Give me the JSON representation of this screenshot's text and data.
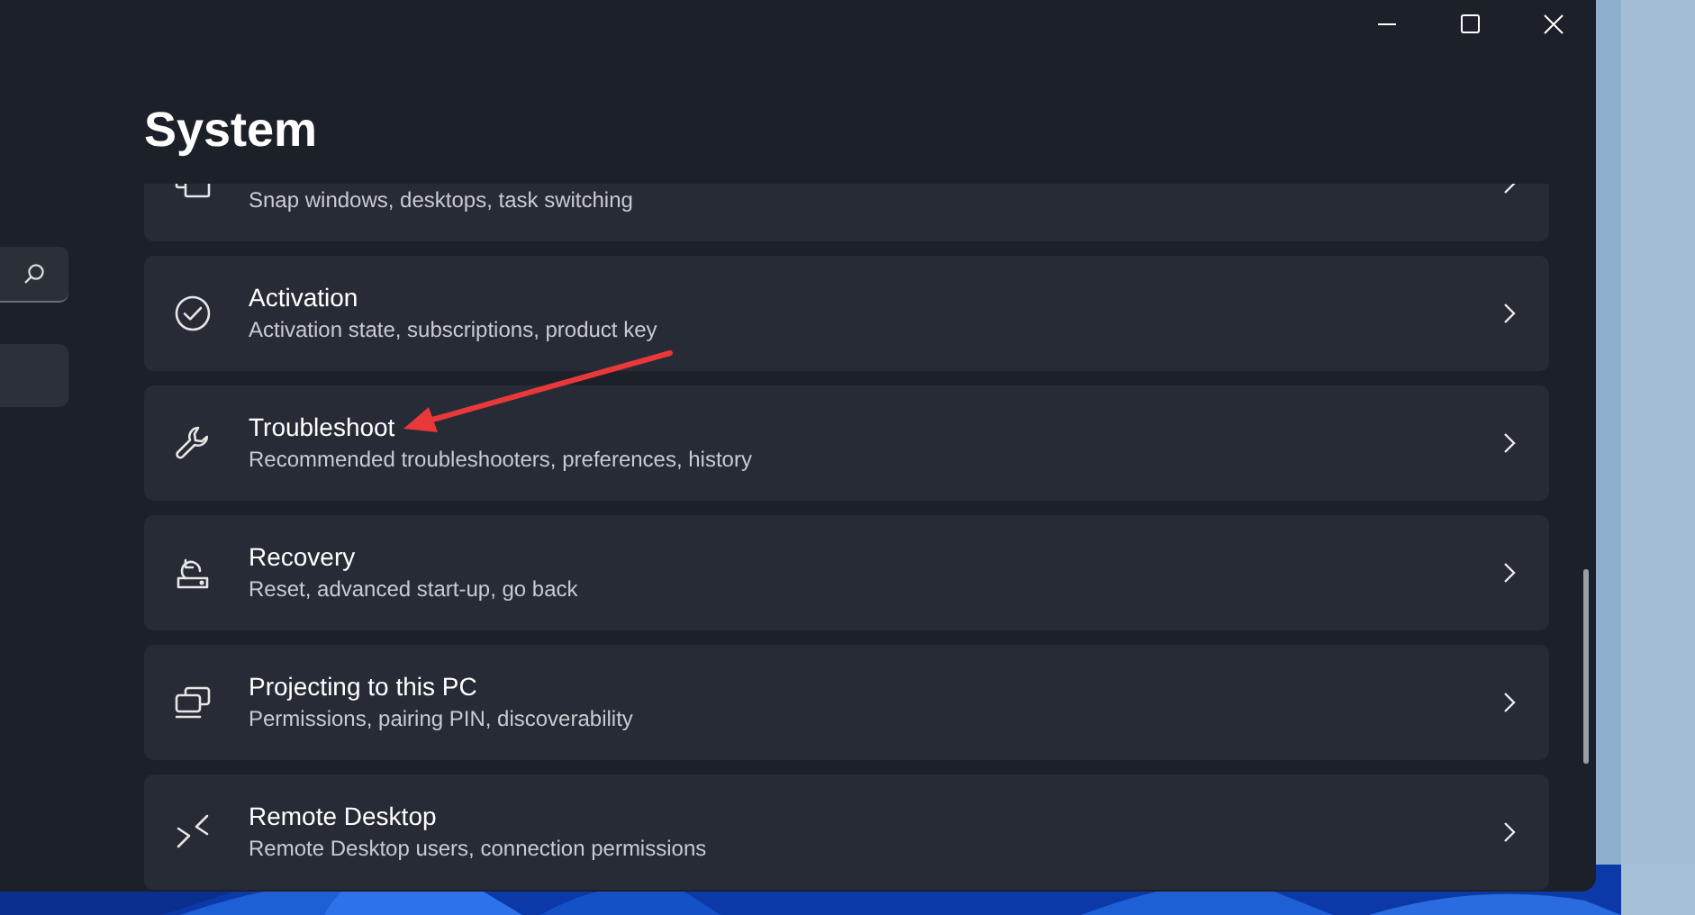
{
  "window": {
    "title": "System"
  },
  "sidebar": {
    "search": {
      "kind": "search"
    },
    "items": [
      {
        "selected": true
      }
    ]
  },
  "settings": [
    {
      "subtitle": "Snap windows, desktops, task switching"
    },
    {
      "title": "Activation",
      "subtitle": "Activation state, subscriptions, product key"
    },
    {
      "title": "Troubleshoot",
      "subtitle": "Recommended troubleshooters, preferences, history"
    },
    {
      "title": "Recovery",
      "subtitle": "Reset, advanced start-up, go back"
    },
    {
      "title": "Projecting to this PC",
      "subtitle": "Permissions, pairing PIN, discoverability"
    },
    {
      "title": "Remote Desktop",
      "subtitle": "Remote Desktop users, connection permissions"
    }
  ]
}
